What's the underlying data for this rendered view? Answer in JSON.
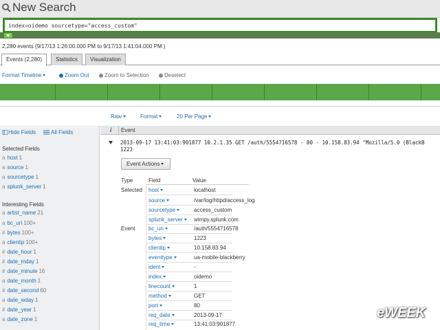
{
  "app": {
    "title": "New Search",
    "search_query": "index=oidemo sourcetype=\"access_custom\"",
    "event_summary": "2,280 events (9/17/13 1:26:00.000 PM to 9/17/13 1:41:04.000 PM )"
  },
  "tabs": [
    {
      "label": "Events (2,280)",
      "active": true
    },
    {
      "label": "Statistics",
      "active": false
    },
    {
      "label": "Visualization",
      "active": false
    }
  ],
  "timeline_toolbar": {
    "format_timeline": "Format Timeline",
    "zoom_out": "Zoom Out",
    "zoom_to_selection": "Zoom to Selection",
    "deselect": "Deselect"
  },
  "results_toolbar": {
    "raw": "Raw",
    "format": "Format",
    "per_page": "20 Per Page"
  },
  "sidebar": {
    "hide_fields": "Hide Fields",
    "all_fields": "All Fields",
    "selected_title": "Selected Fields",
    "selected": [
      {
        "name": "host",
        "count": "1"
      },
      {
        "name": "source",
        "count": "1"
      },
      {
        "name": "sourcetype",
        "count": "1"
      },
      {
        "name": "splunk_server",
        "count": "1"
      }
    ],
    "interesting_title": "Interesting Fields",
    "interesting": [
      {
        "name": "artist_name",
        "count": "21"
      },
      {
        "name": "bc_uri",
        "count": "100+"
      },
      {
        "name": "bytes",
        "count": "100+"
      },
      {
        "name": "clientip",
        "count": "100+"
      },
      {
        "name": "date_hour",
        "count": "1"
      },
      {
        "name": "date_mday",
        "count": "1"
      },
      {
        "name": "date_minute",
        "count": "16"
      },
      {
        "name": "date_month",
        "count": "1"
      },
      {
        "name": "date_second",
        "count": "60"
      },
      {
        "name": "date_wday",
        "count": "1"
      },
      {
        "name": "date_year",
        "count": "1"
      },
      {
        "name": "date_zone",
        "count": "1"
      }
    ]
  },
  "event_table": {
    "i_header": "i",
    "event_header": "Event",
    "raw_line1": "2013-09-17 13:41:03:901877 10.2.1.35 GET /auth/5554716578 - 80 - 10.158.83.94 \"Mozilla/5.0 (BlackB",
    "raw_line2": "1223",
    "event_actions": "Event Actions",
    "col_type": "Type",
    "col_field": "Field",
    "col_value": "Value",
    "rows": [
      {
        "group": "Selected",
        "field": "host",
        "value": "localhost"
      },
      {
        "group": "",
        "field": "source",
        "value": "/var/log/httpd/access_log"
      },
      {
        "group": "",
        "field": "sourcetype",
        "value": "access_custom"
      },
      {
        "group": "",
        "field": "splunk_server",
        "value": "wimpy.splunk.com"
      },
      {
        "group": "Event",
        "field": "bc_uri",
        "value": "/auth/5554716578"
      },
      {
        "group": "",
        "field": "bytes",
        "value": "1223"
      },
      {
        "group": "",
        "field": "clientip",
        "value": "10.158.83.94"
      },
      {
        "group": "",
        "field": "eventtype",
        "value": "ua-mobile-blackberry"
      },
      {
        "group": "",
        "field": "ident",
        "value": "-"
      },
      {
        "group": "",
        "field": "index",
        "value": "oidemo"
      },
      {
        "group": "",
        "field": "linecount",
        "value": "1"
      },
      {
        "group": "",
        "field": "method",
        "value": "GET"
      },
      {
        "group": "",
        "field": "port",
        "value": "80"
      },
      {
        "group": "",
        "field": "req_date",
        "value": "2013-09-17"
      },
      {
        "group": "",
        "field": "req_time",
        "value": "13:41:03:901877"
      }
    ]
  },
  "watermark": "eWEEK",
  "colors": {
    "accent_green": "#5aa84a",
    "link_blue": "#1e6fb3",
    "search_border": "#3d8a2a"
  }
}
